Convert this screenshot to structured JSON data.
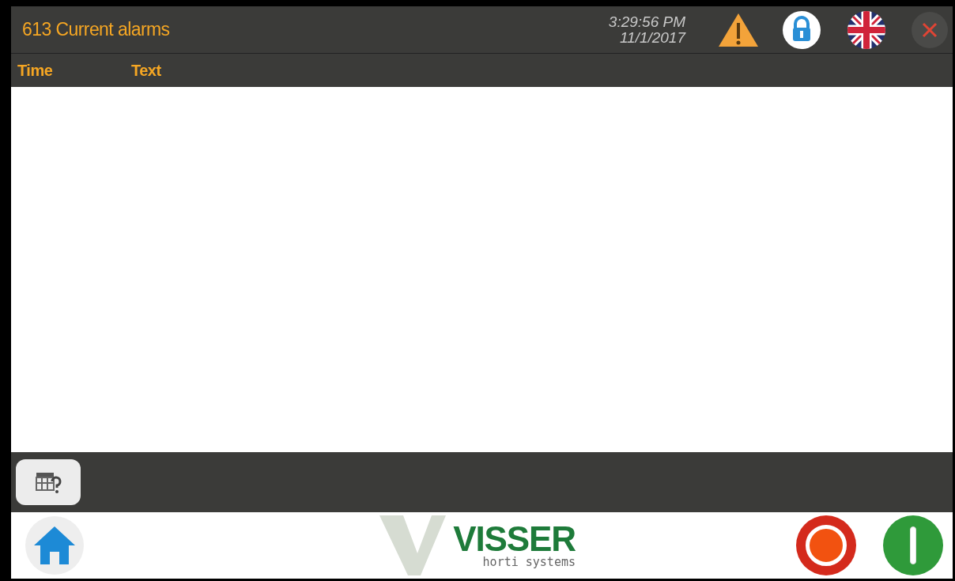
{
  "header": {
    "title": "613 Current alarms",
    "time": "3:29:56 PM",
    "date": "11/1/2017"
  },
  "table": {
    "columns": [
      "Time",
      "Text"
    ]
  },
  "logo": {
    "name": "VISSER",
    "tagline": "horti systems"
  }
}
